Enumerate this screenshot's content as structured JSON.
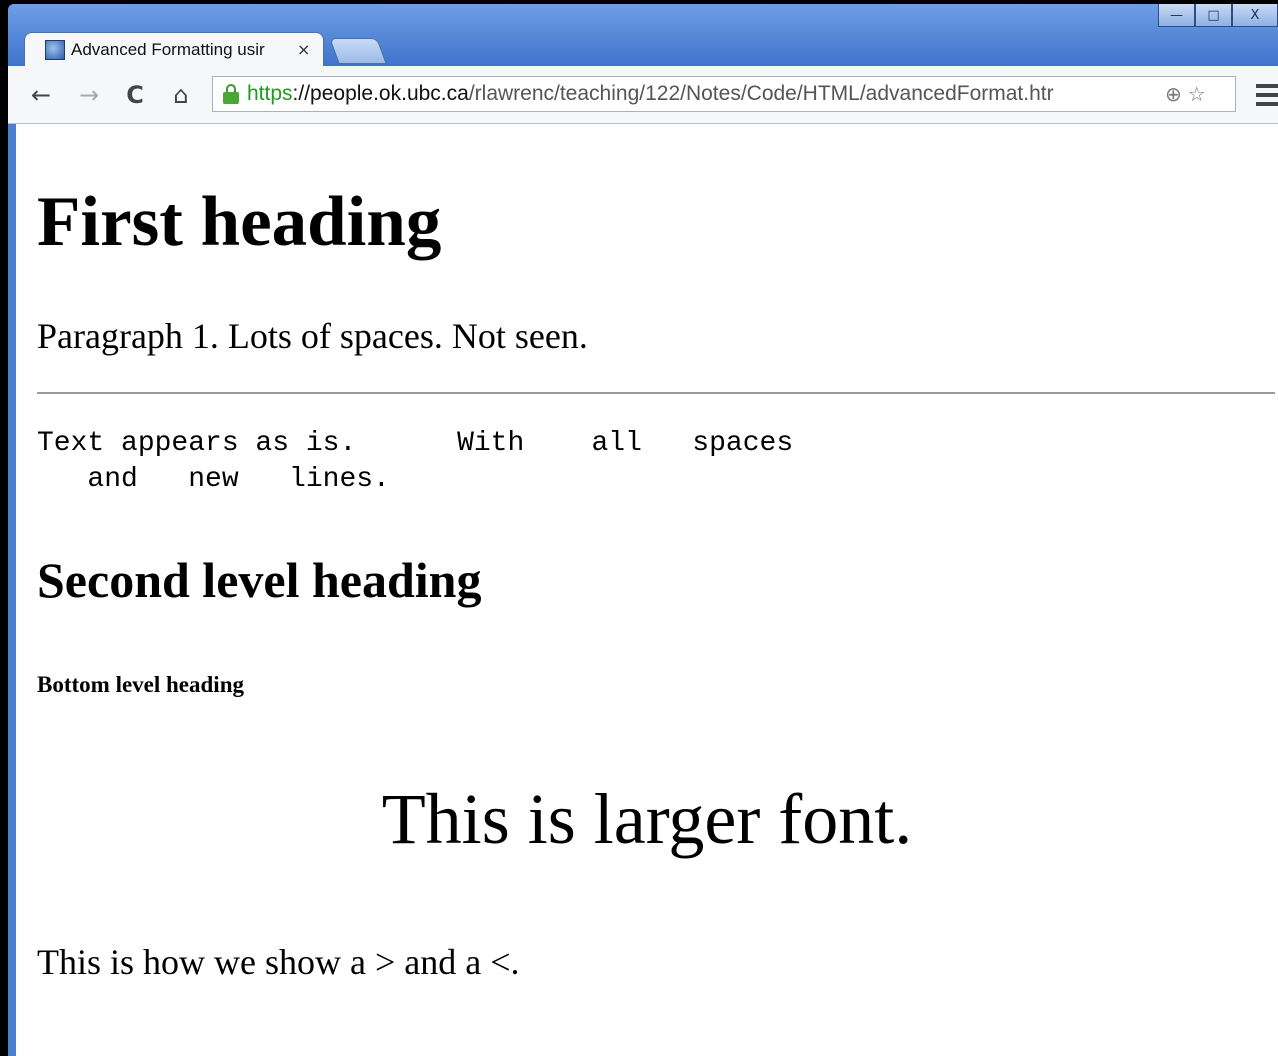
{
  "browser": {
    "tab_title": "Advanced Formatting usir",
    "tab_close": "×",
    "url_scheme": "https",
    "url_host": "://people.ok.ubc.ca",
    "url_path": "/rlawrenc/teaching/122/Notes/Code/HTML/advancedFormat.htr",
    "back_icon": "←",
    "forward_icon": "→",
    "reload_icon": "C",
    "home_icon": "⌂",
    "zoom_icon": "⊕",
    "star_icon": "☆",
    "window_controls": {
      "minimize": "—",
      "maximize": "□",
      "close": "X"
    }
  },
  "page": {
    "heading1": "First heading",
    "paragraph1": "Paragraph 1. Lots of spaces. Not seen.",
    "preformatted": "Text appears as is.      With    all   spaces\n   and   new   lines.",
    "heading2": "Second level heading",
    "heading6": "Bottom level heading",
    "larger_font": "This is larger font.",
    "last_paragraph": "This is how we show a > and a <."
  },
  "colors": {
    "titlebar": "#4a7fd0",
    "secure_green": "#1f9c1f",
    "hr": "#9b9b9b"
  }
}
